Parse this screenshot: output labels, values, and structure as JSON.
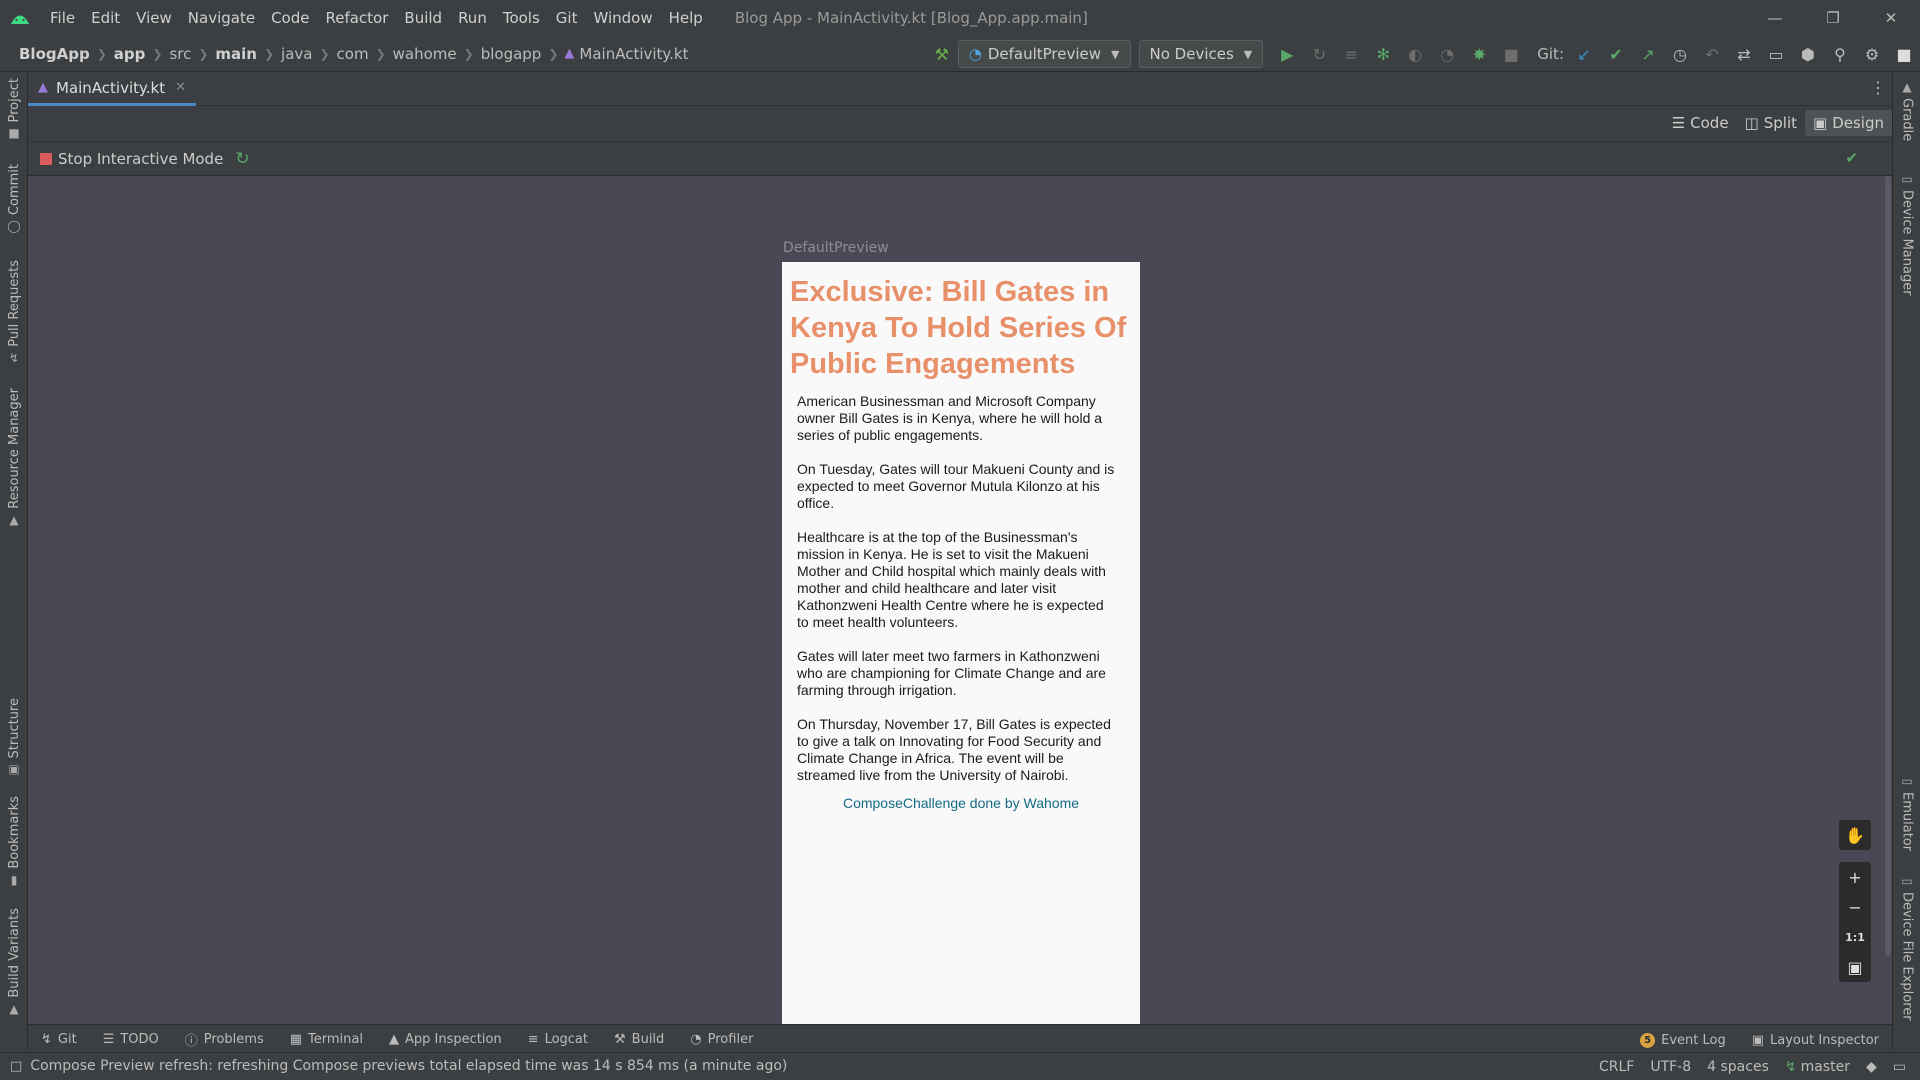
{
  "titlebar": {
    "menu": [
      "File",
      "Edit",
      "View",
      "Navigate",
      "Code",
      "Refactor",
      "Build",
      "Run",
      "Tools",
      "Git",
      "Window",
      "Help"
    ],
    "title": "Blog App - MainActivity.kt [Blog_App.app.main]"
  },
  "breadcrumbs": [
    "BlogApp",
    "app",
    "src",
    "main",
    "java",
    "com",
    "wahome",
    "blogapp",
    "MainActivity.kt"
  ],
  "toolbar": {
    "config": "DefaultPreview",
    "devices": "No Devices",
    "git_label": "Git:"
  },
  "left_tools": [
    "Project",
    "Commit",
    "Pull Requests",
    "Resource Manager",
    "Structure",
    "Bookmarks",
    "Build Variants"
  ],
  "right_tools": [
    "Gradle",
    "Device Manager",
    "Emulator",
    "Device File Explorer"
  ],
  "editor_tab": "MainActivity.kt",
  "modes": {
    "code": "Code",
    "split": "Split",
    "design": "Design"
  },
  "interactive": {
    "label": "Stop Interactive Mode"
  },
  "preview": {
    "label": "DefaultPreview",
    "headline": "Exclusive: Bill Gates in Kenya To Hold Series Of Public Engagements",
    "paragraphs": [
      "American Businessman and Microsoft Company\nowner Bill Gates is in Kenya, where he will hold a\nseries of public engagements.",
      "On Tuesday, Gates will tour Makueni County and is\nexpected to meet Governor Mutula Kilonzo at his\noffice.",
      "Healthcare is at the top of the Businessman's\nmission in Kenya. He is set to visit the Makueni\nMother and Child hospital which mainly deals with\nmother and child healthcare and later visit\nKathonzweni Health Centre where he is expected\nto meet health volunteers.",
      "Gates will later meet two farmers in Kathonzweni\nwho are championing for Climate Change and are\nfarming through irrigation.",
      "On Thursday, November 17, Bill Gates is expected\nto give a talk on Innovating for Food Security and\nClimate Change in Africa. The event will be\nstreamed live from the University of Nairobi."
    ],
    "footer": "ComposeChallenge done by Wahome",
    "headline_color": "#e8906a",
    "footer_color": "#136b86"
  },
  "zoom": {
    "one_to_one": "1:1"
  },
  "tool_windows": [
    "Git",
    "TODO",
    "Problems",
    "Terminal",
    "App Inspection",
    "Logcat",
    "Build",
    "Profiler"
  ],
  "tool_windows_right": [
    "Event Log",
    "Layout Inspector"
  ],
  "event_log_count": "5",
  "status": {
    "message": "Compose Preview refresh: refreshing Compose previews total elapsed time was 14 s 854 ms (a minute ago)",
    "line_sep": "CRLF",
    "encoding": "UTF-8",
    "indent": "4 spaces",
    "branch": "master"
  }
}
